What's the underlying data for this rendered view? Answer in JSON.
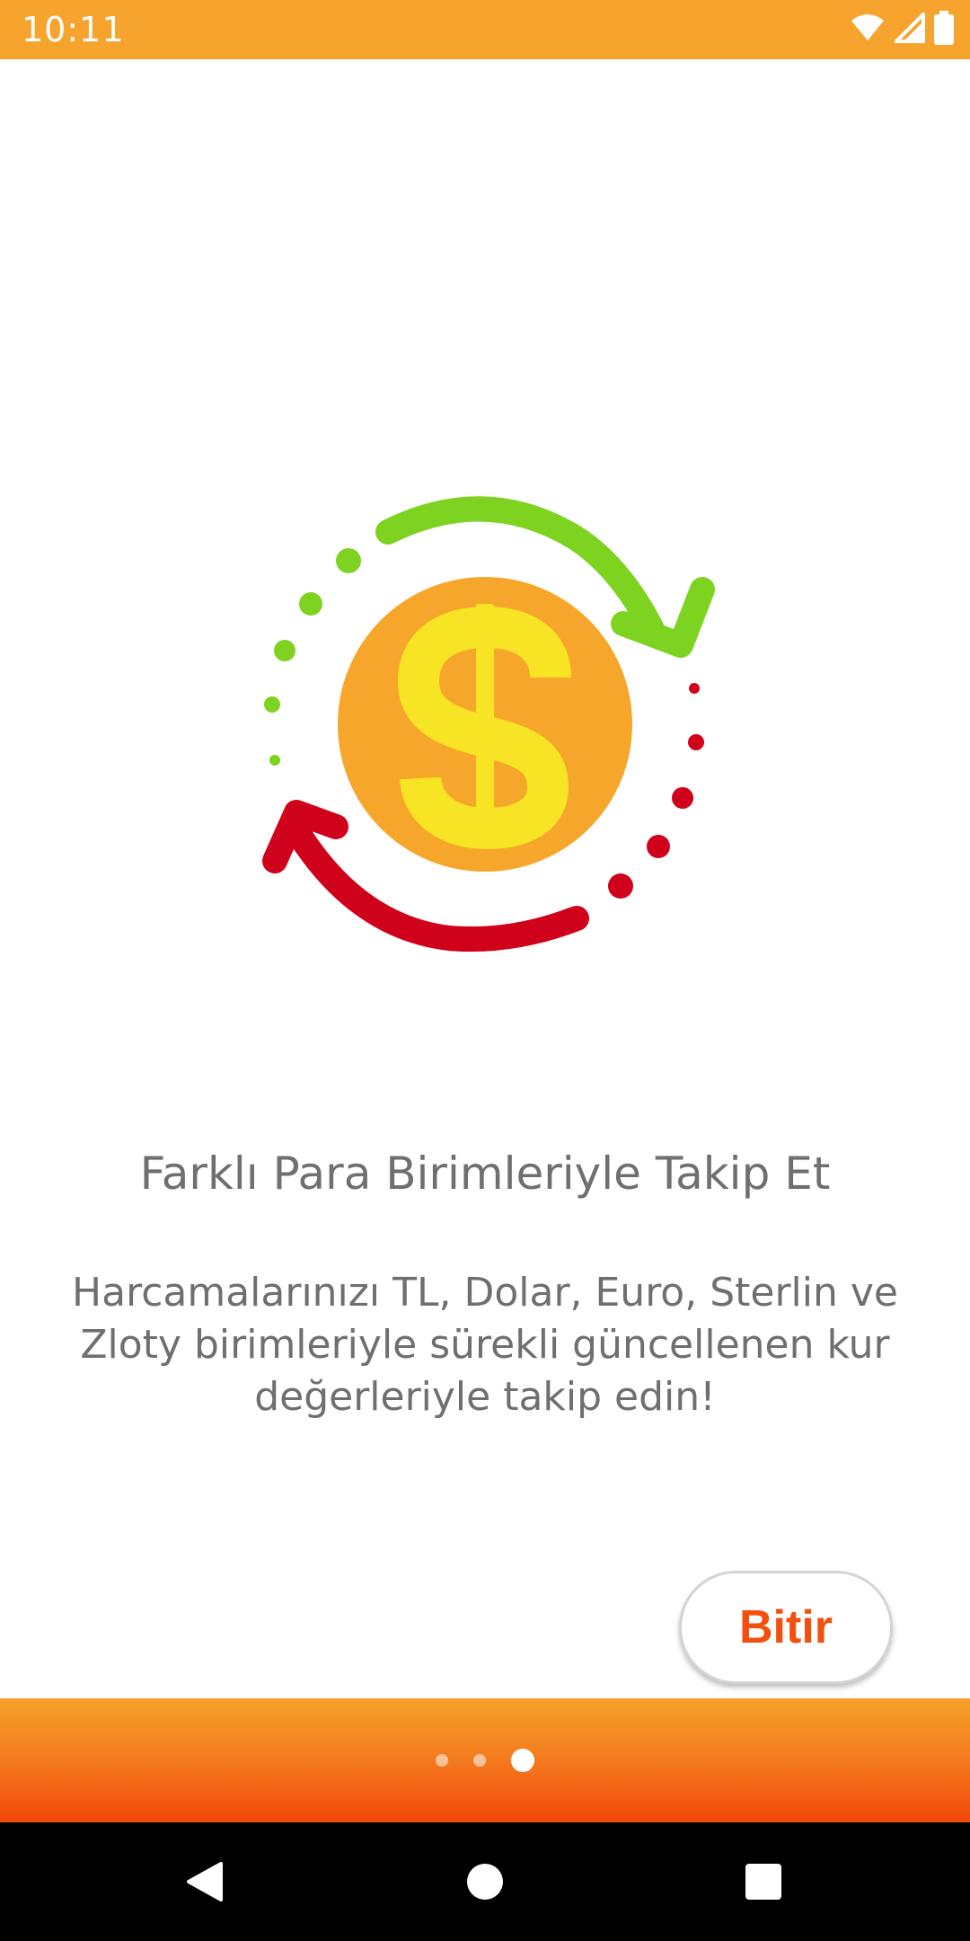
{
  "status_bar": {
    "time": "10:11",
    "icons": [
      "wifi-icon",
      "signal-icon",
      "battery-icon"
    ],
    "background_color": "#F6A42E"
  },
  "onboarding": {
    "illustration": "currency-exchange-icon",
    "title": "Farklı Para Birimleriyle Takip Et",
    "description": "Harcamalarınızı TL, Dolar, Euro, Sterlin ve Zloty birimleriyle sürekli güncellenen kur değerleriyle takip edin!",
    "finish_label": "Bitir",
    "page_count": 3,
    "current_page": 3
  },
  "colors": {
    "accent": "#F2500E",
    "coin": "#F6A62A",
    "dollar": "#F7E424",
    "green_arrow": "#7ED321",
    "red_arrow": "#D0021B",
    "text": "#6f6f6f"
  },
  "nav_bar": {
    "buttons": [
      "back-icon",
      "home-icon",
      "recents-icon"
    ]
  }
}
